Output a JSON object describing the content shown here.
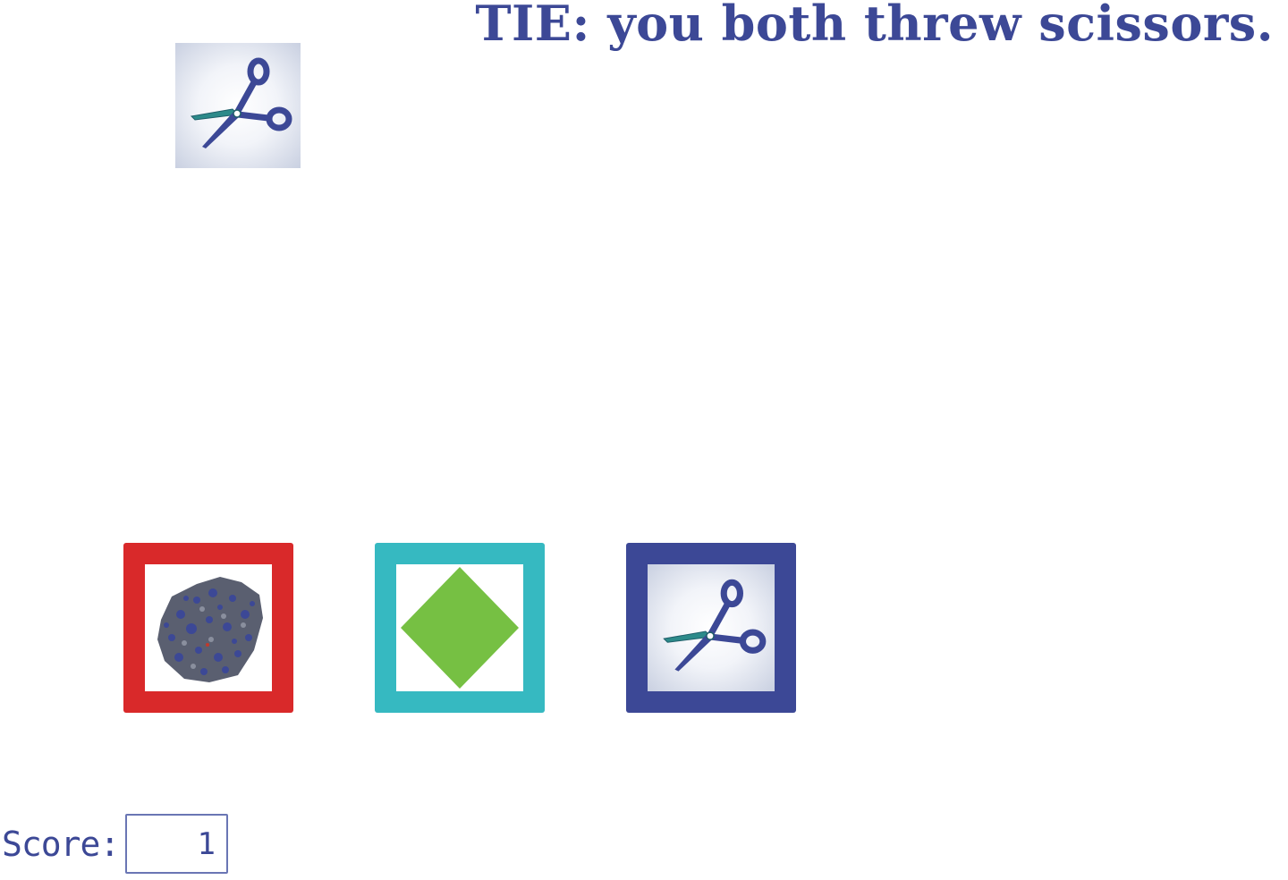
{
  "result": {
    "message": "TIE: you both threw scissors."
  },
  "computer_throw": {
    "choice": "scissors",
    "icon": "scissors-icon"
  },
  "choices": [
    {
      "name": "rock",
      "icon": "rock-icon",
      "frame_color": "#d9292a"
    },
    {
      "name": "paper",
      "icon": "paper-icon",
      "frame_color": "#36b9c1"
    },
    {
      "name": "scissors",
      "icon": "scissors-icon",
      "frame_color": "#3c4896"
    }
  ],
  "score": {
    "label": "Score:",
    "value": "1"
  },
  "colors": {
    "text": "#3c4896",
    "rock_frame": "#d9292a",
    "paper_frame": "#36b9c1",
    "paper_diamond": "#76c043",
    "scissors_frame": "#3c4896"
  }
}
